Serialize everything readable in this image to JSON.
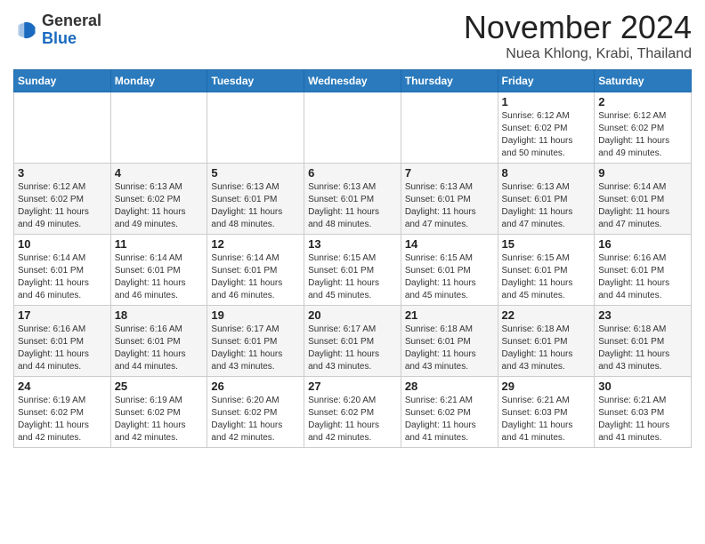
{
  "header": {
    "logo_general": "General",
    "logo_blue": "Blue",
    "month": "November 2024",
    "location": "Nuea Khlong, Krabi, Thailand"
  },
  "calendar": {
    "days_of_week": [
      "Sunday",
      "Monday",
      "Tuesday",
      "Wednesday",
      "Thursday",
      "Friday",
      "Saturday"
    ],
    "weeks": [
      [
        {
          "day": "",
          "info": ""
        },
        {
          "day": "",
          "info": ""
        },
        {
          "day": "",
          "info": ""
        },
        {
          "day": "",
          "info": ""
        },
        {
          "day": "",
          "info": ""
        },
        {
          "day": "1",
          "info": "Sunrise: 6:12 AM\nSunset: 6:02 PM\nDaylight: 11 hours\nand 50 minutes."
        },
        {
          "day": "2",
          "info": "Sunrise: 6:12 AM\nSunset: 6:02 PM\nDaylight: 11 hours\nand 49 minutes."
        }
      ],
      [
        {
          "day": "3",
          "info": "Sunrise: 6:12 AM\nSunset: 6:02 PM\nDaylight: 11 hours\nand 49 minutes."
        },
        {
          "day": "4",
          "info": "Sunrise: 6:13 AM\nSunset: 6:02 PM\nDaylight: 11 hours\nand 49 minutes."
        },
        {
          "day": "5",
          "info": "Sunrise: 6:13 AM\nSunset: 6:01 PM\nDaylight: 11 hours\nand 48 minutes."
        },
        {
          "day": "6",
          "info": "Sunrise: 6:13 AM\nSunset: 6:01 PM\nDaylight: 11 hours\nand 48 minutes."
        },
        {
          "day": "7",
          "info": "Sunrise: 6:13 AM\nSunset: 6:01 PM\nDaylight: 11 hours\nand 47 minutes."
        },
        {
          "day": "8",
          "info": "Sunrise: 6:13 AM\nSunset: 6:01 PM\nDaylight: 11 hours\nand 47 minutes."
        },
        {
          "day": "9",
          "info": "Sunrise: 6:14 AM\nSunset: 6:01 PM\nDaylight: 11 hours\nand 47 minutes."
        }
      ],
      [
        {
          "day": "10",
          "info": "Sunrise: 6:14 AM\nSunset: 6:01 PM\nDaylight: 11 hours\nand 46 minutes."
        },
        {
          "day": "11",
          "info": "Sunrise: 6:14 AM\nSunset: 6:01 PM\nDaylight: 11 hours\nand 46 minutes."
        },
        {
          "day": "12",
          "info": "Sunrise: 6:14 AM\nSunset: 6:01 PM\nDaylight: 11 hours\nand 46 minutes."
        },
        {
          "day": "13",
          "info": "Sunrise: 6:15 AM\nSunset: 6:01 PM\nDaylight: 11 hours\nand 45 minutes."
        },
        {
          "day": "14",
          "info": "Sunrise: 6:15 AM\nSunset: 6:01 PM\nDaylight: 11 hours\nand 45 minutes."
        },
        {
          "day": "15",
          "info": "Sunrise: 6:15 AM\nSunset: 6:01 PM\nDaylight: 11 hours\nand 45 minutes."
        },
        {
          "day": "16",
          "info": "Sunrise: 6:16 AM\nSunset: 6:01 PM\nDaylight: 11 hours\nand 44 minutes."
        }
      ],
      [
        {
          "day": "17",
          "info": "Sunrise: 6:16 AM\nSunset: 6:01 PM\nDaylight: 11 hours\nand 44 minutes."
        },
        {
          "day": "18",
          "info": "Sunrise: 6:16 AM\nSunset: 6:01 PM\nDaylight: 11 hours\nand 44 minutes."
        },
        {
          "day": "19",
          "info": "Sunrise: 6:17 AM\nSunset: 6:01 PM\nDaylight: 11 hours\nand 43 minutes."
        },
        {
          "day": "20",
          "info": "Sunrise: 6:17 AM\nSunset: 6:01 PM\nDaylight: 11 hours\nand 43 minutes."
        },
        {
          "day": "21",
          "info": "Sunrise: 6:18 AM\nSunset: 6:01 PM\nDaylight: 11 hours\nand 43 minutes."
        },
        {
          "day": "22",
          "info": "Sunrise: 6:18 AM\nSunset: 6:01 PM\nDaylight: 11 hours\nand 43 minutes."
        },
        {
          "day": "23",
          "info": "Sunrise: 6:18 AM\nSunset: 6:01 PM\nDaylight: 11 hours\nand 43 minutes."
        }
      ],
      [
        {
          "day": "24",
          "info": "Sunrise: 6:19 AM\nSunset: 6:02 PM\nDaylight: 11 hours\nand 42 minutes."
        },
        {
          "day": "25",
          "info": "Sunrise: 6:19 AM\nSunset: 6:02 PM\nDaylight: 11 hours\nand 42 minutes."
        },
        {
          "day": "26",
          "info": "Sunrise: 6:20 AM\nSunset: 6:02 PM\nDaylight: 11 hours\nand 42 minutes."
        },
        {
          "day": "27",
          "info": "Sunrise: 6:20 AM\nSunset: 6:02 PM\nDaylight: 11 hours\nand 42 minutes."
        },
        {
          "day": "28",
          "info": "Sunrise: 6:21 AM\nSunset: 6:02 PM\nDaylight: 11 hours\nand 41 minutes."
        },
        {
          "day": "29",
          "info": "Sunrise: 6:21 AM\nSunset: 6:03 PM\nDaylight: 11 hours\nand 41 minutes."
        },
        {
          "day": "30",
          "info": "Sunrise: 6:21 AM\nSunset: 6:03 PM\nDaylight: 11 hours\nand 41 minutes."
        }
      ]
    ]
  }
}
